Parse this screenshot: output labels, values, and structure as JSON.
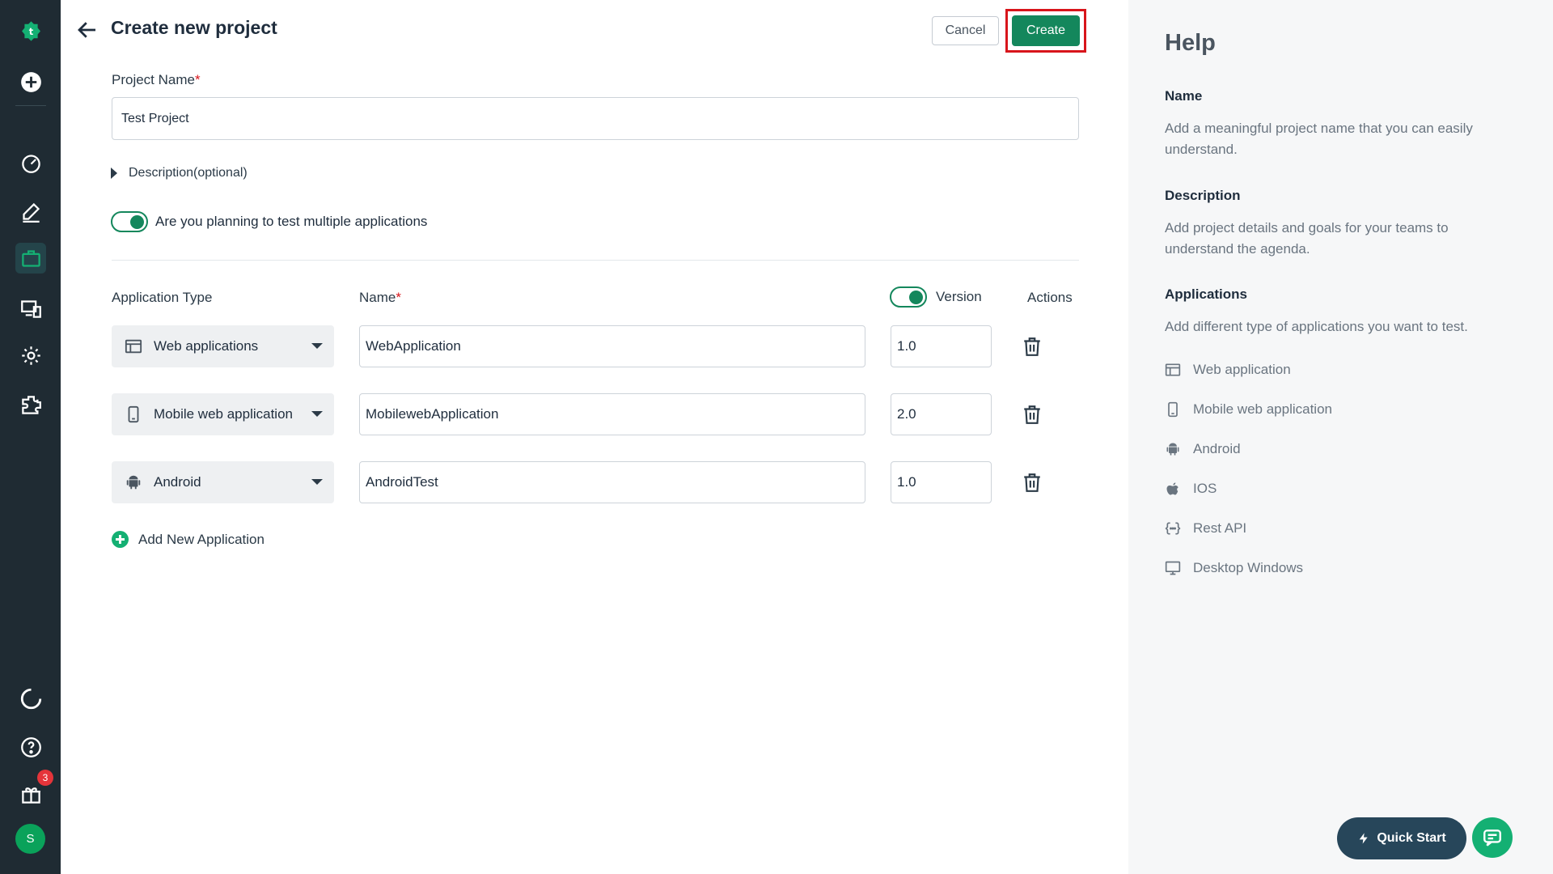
{
  "rail": {
    "badge_count": "3",
    "avatar_initial": "S",
    "icons": [
      "logo-icon",
      "add-icon",
      "dashboard-icon",
      "edit-icon",
      "projects-icon",
      "devices-icon",
      "settings-icon",
      "addons-icon",
      "loading-icon",
      "help-icon",
      "gift-icon"
    ]
  },
  "header": {
    "title": "Create new project",
    "cancel_label": "Cancel",
    "create_label": "Create"
  },
  "form": {
    "project_name_label": "Project Name",
    "required_mark": "*",
    "project_name_value": "Test Project",
    "description_label": "Description(optional)",
    "multi_app_label": "Are you planning to test multiple applications",
    "multi_app_enabled": true
  },
  "apps_table": {
    "col_type": "Application Type",
    "col_name": "Name",
    "col_version": "Version",
    "col_actions": "Actions",
    "version_enabled": true,
    "rows": [
      {
        "type": "Web applications",
        "icon": "web-app-icon",
        "name": "WebApplication",
        "version": "1.0"
      },
      {
        "type": "Mobile web application",
        "icon": "mobile-icon",
        "name": "MobilewebApplication",
        "version": "2.0"
      },
      {
        "type": "Android",
        "icon": "android-icon",
        "name": "AndroidTest",
        "version": "1.0"
      }
    ],
    "add_label": "Add New Application"
  },
  "help": {
    "title": "Help",
    "name_heading": "Name",
    "name_text": "Add a meaningful project name that you can easily understand.",
    "desc_heading": "Description",
    "desc_text": "Add project details and goals for your teams to understand the agenda.",
    "apps_heading": "Applications",
    "apps_text": "Add different type of applications you want to test.",
    "app_types": [
      {
        "label": "Web application",
        "icon": "web-app-icon"
      },
      {
        "label": "Mobile web application",
        "icon": "mobile-icon"
      },
      {
        "label": "Android",
        "icon": "android-icon"
      },
      {
        "label": "IOS",
        "icon": "apple-icon"
      },
      {
        "label": "Rest API",
        "icon": "api-icon"
      },
      {
        "label": "Desktop Windows",
        "icon": "desktop-icon"
      }
    ]
  },
  "footer": {
    "quick_start_label": "Quick Start"
  },
  "colors": {
    "brand_green": "#14875c",
    "accent_green": "#14b073",
    "rail_bg": "#1f2b33",
    "highlight_red": "#d8151b"
  }
}
